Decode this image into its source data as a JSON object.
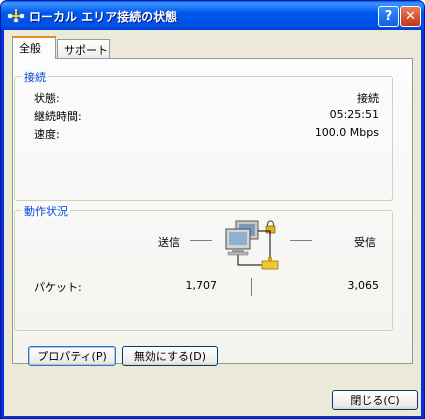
{
  "window": {
    "title": "ローカル エリア接続の状態",
    "help_label": "?",
    "close_label": "✕"
  },
  "tabs": [
    {
      "label": "全般",
      "active": true
    },
    {
      "label": "サポート",
      "active": false
    }
  ],
  "connection": {
    "group_title": "接続",
    "rows": [
      {
        "label": "状態:",
        "value": "接続"
      },
      {
        "label": "継続時間:",
        "value": "05:25:51"
      },
      {
        "label": "速度:",
        "value": "100.0 Mbps"
      }
    ]
  },
  "activity": {
    "group_title": "動作状況",
    "sent_label": "送信",
    "received_label": "受信",
    "packets_label": "パケット:",
    "packets_sent": "1,707",
    "packets_received": "3,065"
  },
  "buttons": {
    "properties": "プロパティ(P)",
    "disable": "無効にする(D)",
    "close": "閉じる(C)"
  },
  "colors": {
    "titlebar": "#0058ee",
    "group_title": "#0046d5",
    "dialog_bg": "#ece9d8",
    "close_button": "#c4361a"
  }
}
